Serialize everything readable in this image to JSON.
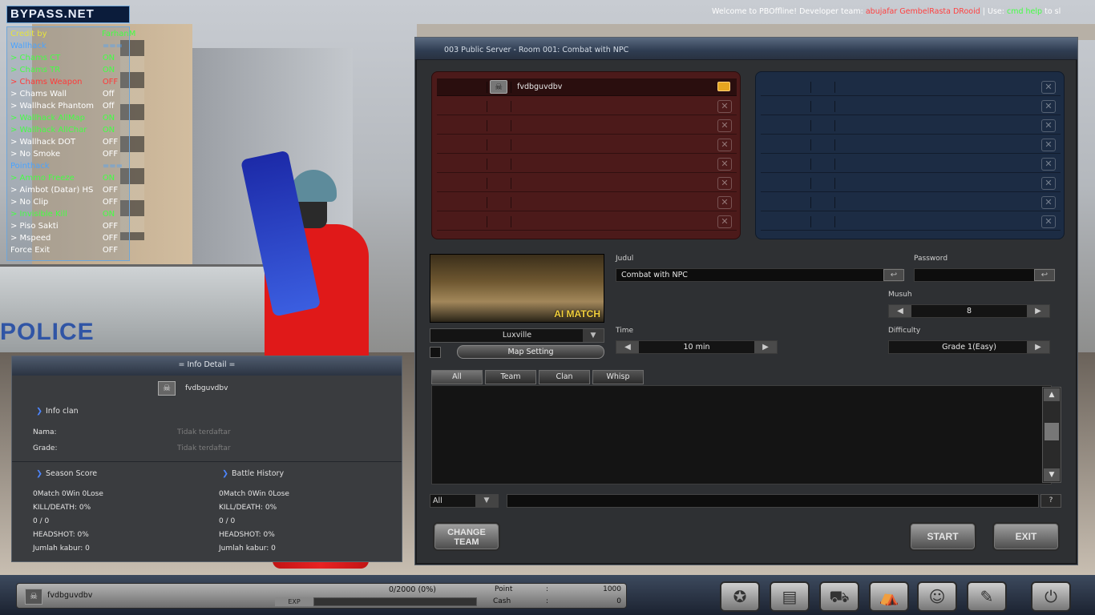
{
  "top": {
    "logo": "BYPASS.NET",
    "welcome_prefix": "Welcome to PBOffline! Developer team: ",
    "welcome_team": "abujafar GembelRasta DRooid",
    "welcome_sep": " | Use: ",
    "welcome_cmd": "cmd help",
    "welcome_suffix": " to sl"
  },
  "cheat": {
    "rows": [
      {
        "name": "Credit by",
        "value": "FarhanM",
        "color": "#e7e43a",
        "vcolor": "#44ff44"
      },
      {
        "name": "Wallhack",
        "value": "===",
        "color": "#4aa3ff",
        "vcolor": "#4aa3ff"
      },
      {
        "name": ">    Chams CT",
        "value": "ON",
        "color": "#44ff44",
        "vcolor": "#44ff44"
      },
      {
        "name": ">    Chams TR",
        "value": "ON",
        "color": "#44ff44",
        "vcolor": "#44ff44"
      },
      {
        "name": ">    Chams Weapon",
        "value": "OFF",
        "color": "#ff3a3a",
        "vcolor": "#ff3a3a"
      },
      {
        "name": ">    Chams Wall",
        "value": "Off",
        "color": "#ffffff",
        "vcolor": "#ffffff"
      },
      {
        "name": ">    Wallhack Phantom",
        "value": "Off",
        "color": "#ffffff",
        "vcolor": "#ffffff"
      },
      {
        "name": ">    Wallhack AllMap",
        "value": "ON",
        "color": "#44ff44",
        "vcolor": "#44ff44"
      },
      {
        "name": ">    Wallhack AllChar",
        "value": "ON",
        "color": "#44ff44",
        "vcolor": "#44ff44"
      },
      {
        "name": ">    Wallhack DOT",
        "value": "OFF",
        "color": "#ffffff",
        "vcolor": "#ffffff"
      },
      {
        "name": ">    No Smoke",
        "value": "OFF",
        "color": "#ffffff",
        "vcolor": "#ffffff"
      },
      {
        "name": "Pointhack",
        "value": "===",
        "color": "#4aa3ff",
        "vcolor": "#4aa3ff"
      },
      {
        "name": ">    Ammo Freeze",
        "value": "ON",
        "color": "#44ff44",
        "vcolor": "#44ff44"
      },
      {
        "name": ">    Aimbot (Datar) HS",
        "value": "OFF",
        "color": "#ffffff",
        "vcolor": "#ffffff"
      },
      {
        "name": ">    No Clip",
        "value": "OFF",
        "color": "#ffffff",
        "vcolor": "#ffffff"
      },
      {
        "name": ">    Invisible Kill",
        "value": "ON",
        "color": "#44ff44",
        "vcolor": "#44ff44"
      },
      {
        "name": ">    Piso Sakti",
        "value": "OFF",
        "color": "#ffffff",
        "vcolor": "#ffffff"
      },
      {
        "name": ">    Mspeed",
        "value": "OFF",
        "color": "#ffffff",
        "vcolor": "#ffffff"
      },
      {
        "name": "Force Exit",
        "value": "OFF",
        "color": "#ffffff",
        "vcolor": "#ffffff"
      }
    ]
  },
  "room": {
    "title": "003 Public Server - Room 001: Combat with NPC",
    "red_player": "fvdbguvdbv",
    "close_glyph": "✕",
    "map_name": "Luxville",
    "map_badge": "AI MATCH",
    "map_setting": "Map Setting",
    "dropdown_glyph": "▼",
    "arrow_left": "◀",
    "arrow_right": "▶",
    "edit_glyph": "↩",
    "judul_label": "Judul",
    "judul_value": "Combat with NPC",
    "password_label": "Password",
    "password_value": "",
    "musuh_label": "Musuh",
    "musuh_value": "8",
    "time_label": "Time",
    "time_value": "10 min",
    "difficulty_label": "Difficulty",
    "difficulty_value": "Grade 1(Easy)",
    "chat_tabs": [
      "All",
      "Team",
      "Clan",
      "Whisp"
    ],
    "chat_mode": "All",
    "chat_help": "?",
    "scroll_up": "▲",
    "scroll_down": "▼",
    "change_team": "CHANGE TEAM",
    "start": "START",
    "exit": "EXIT"
  },
  "info": {
    "title": "= Info Detail =",
    "player": "fvdbguvdbv",
    "clan_header": "Info clan",
    "nama_label": "Nama:",
    "nama_value": "Tidak terdaftar",
    "grade_label": "Grade:",
    "grade_value": "Tidak terdaftar",
    "season_header": "Season Score",
    "battle_header": "Battle History",
    "season": {
      "match": "0Match 0Win 0Lose",
      "kd": "KILL/DEATH:  0%",
      "kd_nums": "0 / 0",
      "hs": "HEADSHOT:  0%",
      "kabur": "Jumlah kabur: 0"
    },
    "battle": {
      "match": "0Match 0Win 0Lose",
      "kd": "KILL/DEATH:  0%",
      "kd_nums": "0 / 0",
      "hs": "HEADSHOT:  0%",
      "kabur": "Jumlah kabur: 0"
    }
  },
  "status": {
    "name": "fvdbguvdbv",
    "exp_label": "EXP",
    "exp_text": "0/2000 (0%)",
    "exp_fraction": 0,
    "point_label": "Point",
    "point_colon": ":",
    "point_value": "1000",
    "cash_label": "Cash",
    "cash_colon": ":",
    "cash_value": "0"
  },
  "nav_icons": [
    "clan-icon",
    "inventory-icon",
    "shop-icon",
    "cart-icon",
    "community-icon",
    "settings-icon",
    "power-icon"
  ]
}
